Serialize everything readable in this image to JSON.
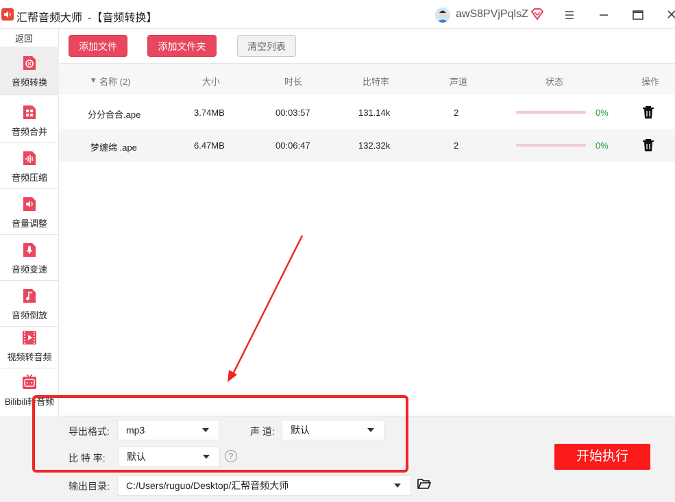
{
  "titlebar": {
    "app_name": "汇帮音频大师",
    "subtitle": "-【音频转换】",
    "username": "awS8PVjPqlsZ",
    "menu_icon": "hamburger-icon",
    "minimize_icon": "minimize-icon",
    "maximize_icon": "maximize-icon",
    "close_icon": "close-icon"
  },
  "sidebar": {
    "back_label": "返回",
    "items": [
      {
        "label": "音频转换",
        "icon": "audio-convert-icon",
        "active": true
      },
      {
        "label": "音频合并",
        "icon": "audio-merge-icon"
      },
      {
        "label": "音频压缩",
        "icon": "audio-compress-icon"
      },
      {
        "label": "音量调整",
        "icon": "volume-icon"
      },
      {
        "label": "音频变速",
        "icon": "microphone-icon"
      },
      {
        "label": "音频倒放",
        "icon": "music-note-icon"
      },
      {
        "label": "视频转音频",
        "icon": "film-icon"
      },
      {
        "label": "Bilibili转音频",
        "icon": "bilibili-tv-icon"
      }
    ]
  },
  "toolbar": {
    "add_file": "添加文件",
    "add_folder": "添加文件夹",
    "clear_list": "清空列表"
  },
  "table": {
    "columns": {
      "name": "名称 (2)",
      "size": "大小",
      "duration": "时长",
      "bitrate": "比特率",
      "channels": "声道",
      "status": "状态",
      "actions": "操作"
    },
    "rows": [
      {
        "name": "分分合合.ape",
        "size": "3.74MB",
        "duration": "00:03:57",
        "bitrate": "131.14k",
        "channels": "2",
        "progress": "0%",
        "progress_value": 0
      },
      {
        "name": "梦缠绵 .ape",
        "size": "6.47MB",
        "duration": "00:06:47",
        "bitrate": "132.32k",
        "channels": "2",
        "progress": "0%",
        "progress_value": 0
      }
    ]
  },
  "settings": {
    "format_label": "导出格式:",
    "format_value": "mp3",
    "channel_label": "声 道:",
    "channel_value": "默认",
    "bitrate_label": "比 特 率:",
    "bitrate_value": "默认",
    "help_glyph": "?",
    "output_label": "输出目录:",
    "output_path": "C:/Users/ruguo/Desktop/汇帮音频大师"
  },
  "start_button": "开始执行",
  "colors": {
    "accent": "#e8475f",
    "start": "#fb1a1a",
    "progress_text": "#1f9a3a",
    "annotation": "#f02525"
  }
}
